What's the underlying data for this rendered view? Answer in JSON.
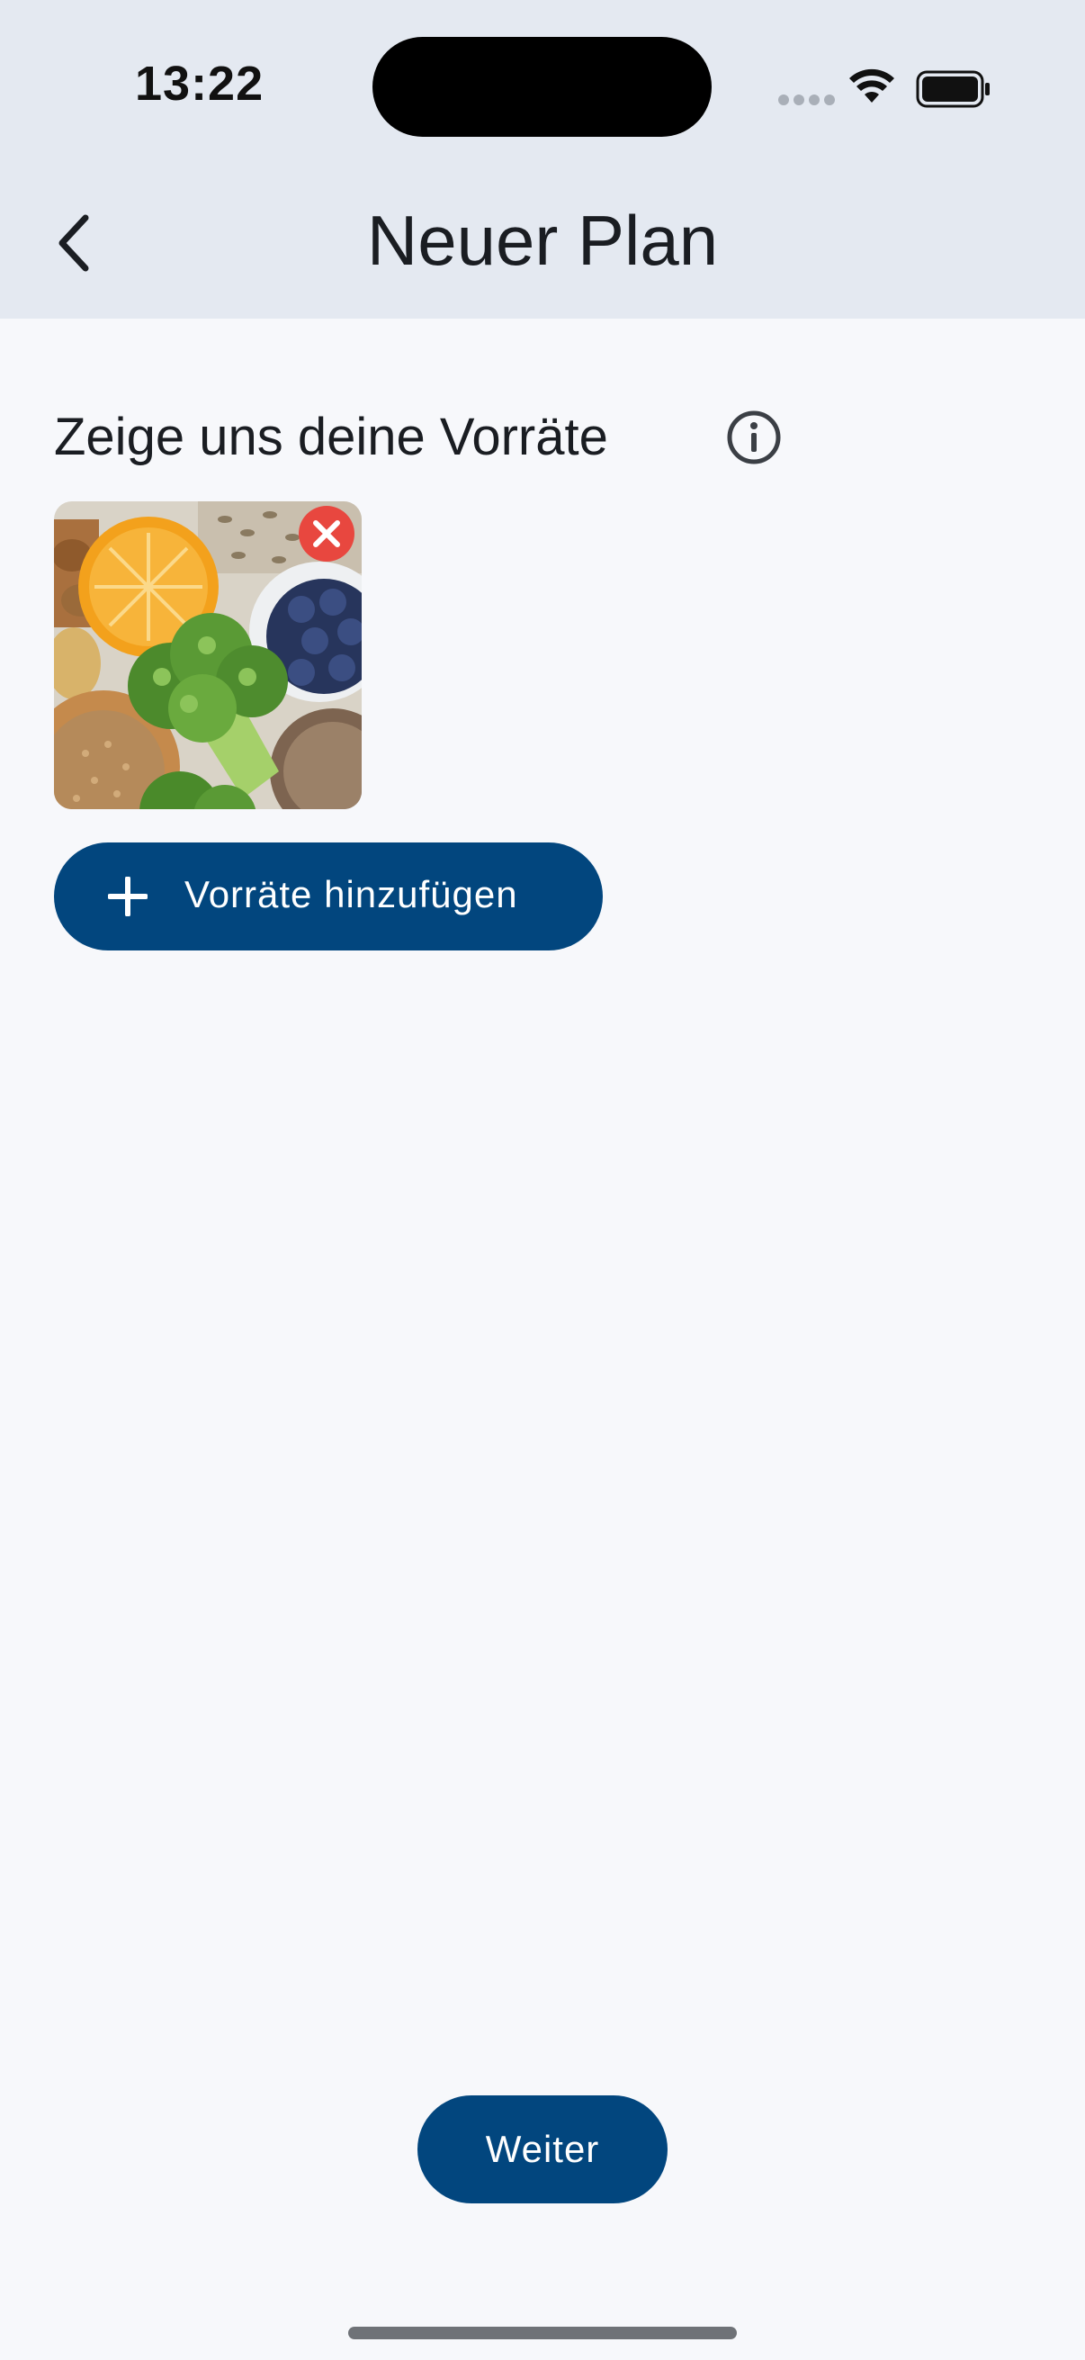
{
  "status_bar": {
    "time": "13:22",
    "icons": [
      "cellular-signal-icon",
      "wifi-icon",
      "battery-icon"
    ]
  },
  "header": {
    "back_icon": "chevron-left-icon",
    "title": "Neuer Plan"
  },
  "section": {
    "title": "Zeige uns deine Vorräte",
    "info_icon": "info-circle-icon"
  },
  "photos": [
    {
      "name": "pantry-photo-1",
      "remove_icon": "close-icon"
    }
  ],
  "add_button": {
    "icon": "plus-icon",
    "label": "Vorräte hinzufügen"
  },
  "next_button": {
    "label": "Weiter"
  },
  "colors": {
    "header_bg": "#e4e9f1",
    "page_bg": "#f7f8fb",
    "primary": "#02467e",
    "remove_red": "#e8473f"
  }
}
